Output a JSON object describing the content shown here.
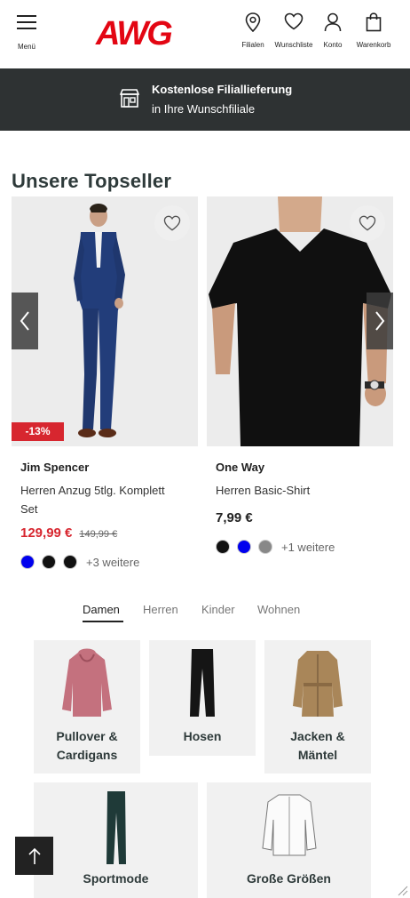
{
  "header": {
    "menu_label": "Menü",
    "logo_text": "AWG",
    "icons": {
      "filialen": "Filialen",
      "wunschliste": "Wunschliste",
      "konto": "Konto",
      "warenkorb": "Warenkorb"
    }
  },
  "promo": {
    "title": "Kostenlose Filiallieferung",
    "subtitle": "in Ihre Wunschfiliale",
    "icon": "store-icon"
  },
  "topseller": {
    "title": "Unsere Topseller",
    "products": [
      {
        "brand": "Jim Spencer",
        "name": "Herren Anzug 5tlg. Komplett Set",
        "price": "129,99 €",
        "old_price": "149,99 €",
        "discount": "-13%",
        "swatches": [
          "#0000ee",
          "#111111",
          "#111111"
        ],
        "more_colors": "+3 weitere"
      },
      {
        "brand": "One Way",
        "name": "Herren Basic-Shirt",
        "price": "7,99 €",
        "swatches": [
          "#111111",
          "#0000ee",
          "#888888"
        ],
        "more_colors": "+1 weitere"
      }
    ]
  },
  "category_tabs": [
    "Damen",
    "Herren",
    "Kinder",
    "Wohnen"
  ],
  "categories": [
    {
      "label_line1": "Pullover &",
      "label_line2": "Cardigans"
    },
    {
      "label_line1": "Hosen",
      "label_line2": ""
    },
    {
      "label_line1": "Jacken &",
      "label_line2": "Mäntel"
    },
    {
      "label_line1": "Sportmode",
      "label_line2": ""
    },
    {
      "label_line1": "Große Größen",
      "label_line2": ""
    }
  ],
  "colors": {
    "brand_red": "#e30613",
    "promo_bg": "#2e3233",
    "sale_red": "#d7262f"
  }
}
